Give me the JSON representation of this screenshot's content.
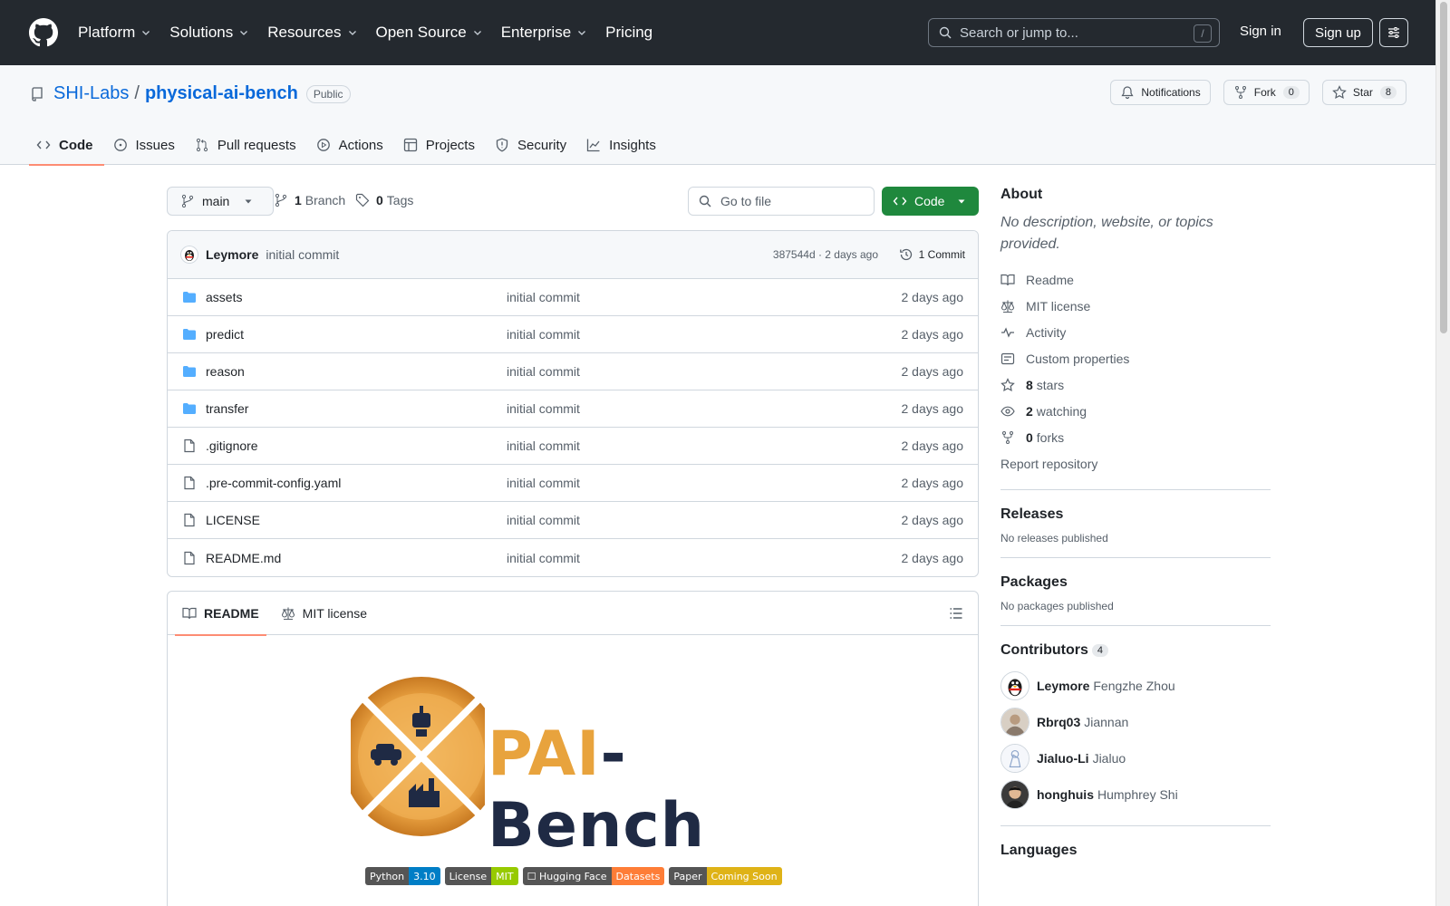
{
  "header": {
    "nav": [
      "Platform",
      "Solutions",
      "Resources",
      "Open Source",
      "Enterprise",
      "Pricing"
    ],
    "search_placeholder": "Search or jump to...",
    "search_shortcut": "/",
    "signin": "Sign in",
    "signup": "Sign up"
  },
  "repo": {
    "owner": "SHI-Labs",
    "separator": "/",
    "name": "physical-ai-bench",
    "visibility": "Public",
    "notifications": "Notifications",
    "fork_label": "Fork",
    "fork_count": "0",
    "star_label": "Star",
    "star_count": "8",
    "tabs": [
      "Code",
      "Issues",
      "Pull requests",
      "Actions",
      "Projects",
      "Security",
      "Insights"
    ]
  },
  "toolbar": {
    "branch": "main",
    "branch_count": "1",
    "branch_label": "Branch",
    "tag_count": "0",
    "tag_label": "Tags",
    "goto_placeholder": "Go to file",
    "code_button": "Code"
  },
  "commit": {
    "author": "Leymore",
    "message": "initial commit",
    "meta": "387544d · 2 days ago",
    "count_label": "1 Commit"
  },
  "files": [
    {
      "name": "assets",
      "type": "dir",
      "commit": "initial commit",
      "date": "2 days ago"
    },
    {
      "name": "predict",
      "type": "dir",
      "commit": "initial commit",
      "date": "2 days ago"
    },
    {
      "name": "reason",
      "type": "dir",
      "commit": "initial commit",
      "date": "2 days ago"
    },
    {
      "name": "transfer",
      "type": "dir",
      "commit": "initial commit",
      "date": "2 days ago"
    },
    {
      "name": ".gitignore",
      "type": "file",
      "commit": "initial commit",
      "date": "2 days ago"
    },
    {
      "name": ".pre-commit-config.yaml",
      "type": "file",
      "commit": "initial commit",
      "date": "2 days ago"
    },
    {
      "name": "LICENSE",
      "type": "file",
      "commit": "initial commit",
      "date": "2 days ago"
    },
    {
      "name": "README.md",
      "type": "file",
      "commit": "initial commit",
      "date": "2 days ago"
    }
  ],
  "readme": {
    "tab_readme": "README",
    "tab_license": "MIT license",
    "logo_part1": "PAI",
    "logo_part2": "-Bench",
    "badges": [
      {
        "label": "Python",
        "value": "3.10",
        "color": "#007ec6"
      },
      {
        "label": "License",
        "value": "MIT",
        "color": "#97ca00"
      },
      {
        "label": "☐ Hugging Face",
        "value": "Datasets",
        "color": "#fe7d37"
      },
      {
        "label": "Paper",
        "value": "Coming Soon",
        "color": "#dfb317"
      }
    ]
  },
  "sidebar": {
    "about_title": "About",
    "about_desc": "No description, website, or topics provided.",
    "links": [
      {
        "icon": "book-icon",
        "label": "Readme",
        "count": ""
      },
      {
        "icon": "law-icon",
        "label": "MIT license",
        "count": ""
      },
      {
        "icon": "pulse-icon",
        "label": "Activity",
        "count": ""
      },
      {
        "icon": "note-icon",
        "label": "Custom properties",
        "count": ""
      },
      {
        "icon": "star-icon",
        "label": "stars",
        "count": "8"
      },
      {
        "icon": "eye-icon",
        "label": "watching",
        "count": "2"
      },
      {
        "icon": "fork-icon",
        "label": "forks",
        "count": "0"
      }
    ],
    "report": "Report repository",
    "releases_title": "Releases",
    "releases_none": "No releases published",
    "packages_title": "Packages",
    "packages_none": "No packages published",
    "contributors_title": "Contributors",
    "contributors_count": "4",
    "contributors": [
      {
        "login": "Leymore",
        "name": "Fengzhe Zhou"
      },
      {
        "login": "Rbrq03",
        "name": "Jiannan"
      },
      {
        "login": "Jialuo-Li",
        "name": "Jialuo"
      },
      {
        "login": "honghuis",
        "name": "Humphrey Shi"
      }
    ],
    "languages_title": "Languages"
  }
}
